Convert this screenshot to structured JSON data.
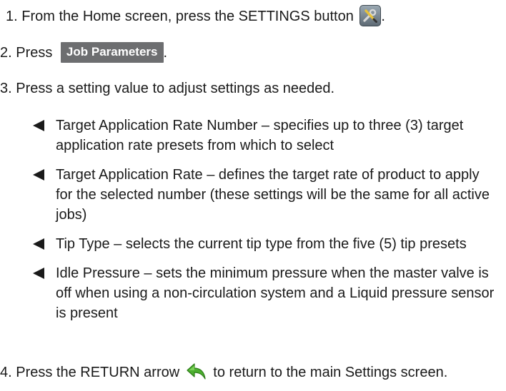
{
  "steps": {
    "step1": {
      "text": "1.  From the Home screen, press the SETTINGS button",
      "icon": "settings-tools-icon",
      "trailing": "."
    },
    "step2": {
      "text": "2. Press",
      "button_label": "Job Parameters",
      "trailing": "."
    },
    "step3": {
      "text": "3. Press a setting value to adjust settings as needed."
    },
    "step4": {
      "text": "4. Press the RETURN arrow",
      "icon": "return-arrow-icon",
      "trailing": "to return to the main Settings screen."
    }
  },
  "bullets": [
    "Target Application Rate Number – specifies up to three (3) target application rate presets from which to select",
    "Target Application Rate – defines the target rate of product to apply for the selected number (these settings will be the same for all active jobs)",
    "Tip Type – selects the current tip type from the five (5) tip presets",
    "Idle Pressure – sets the minimum pressure when the master valve is off when using a non-circulation system and a Liquid pressure sensor is present"
  ],
  "colors": {
    "text": "#1a1a1a",
    "button_chip": "#6d6e70",
    "return_arrow": "#4caf2f"
  }
}
